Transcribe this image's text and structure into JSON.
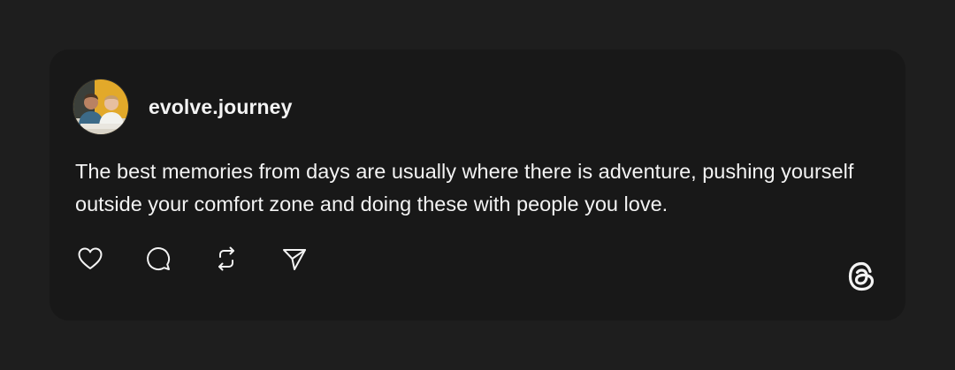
{
  "post": {
    "username": "evolve.journey",
    "text": "The best memories from days are usually where there is adventure, pushing yourself outside your comfort zone and doing these with people you love.",
    "avatar": {
      "icon": "avatar-photo",
      "accent": "#e2a92a"
    }
  },
  "actions": [
    {
      "name": "like",
      "icon": "heart-icon"
    },
    {
      "name": "comment",
      "icon": "comment-icon"
    },
    {
      "name": "repost",
      "icon": "repost-icon"
    },
    {
      "name": "share",
      "icon": "send-icon"
    }
  ],
  "brand": {
    "icon": "threads-logo-icon"
  },
  "colors": {
    "page_background": "#1e1e1e",
    "card_background": "#181818",
    "text": "#f3f3f3"
  }
}
